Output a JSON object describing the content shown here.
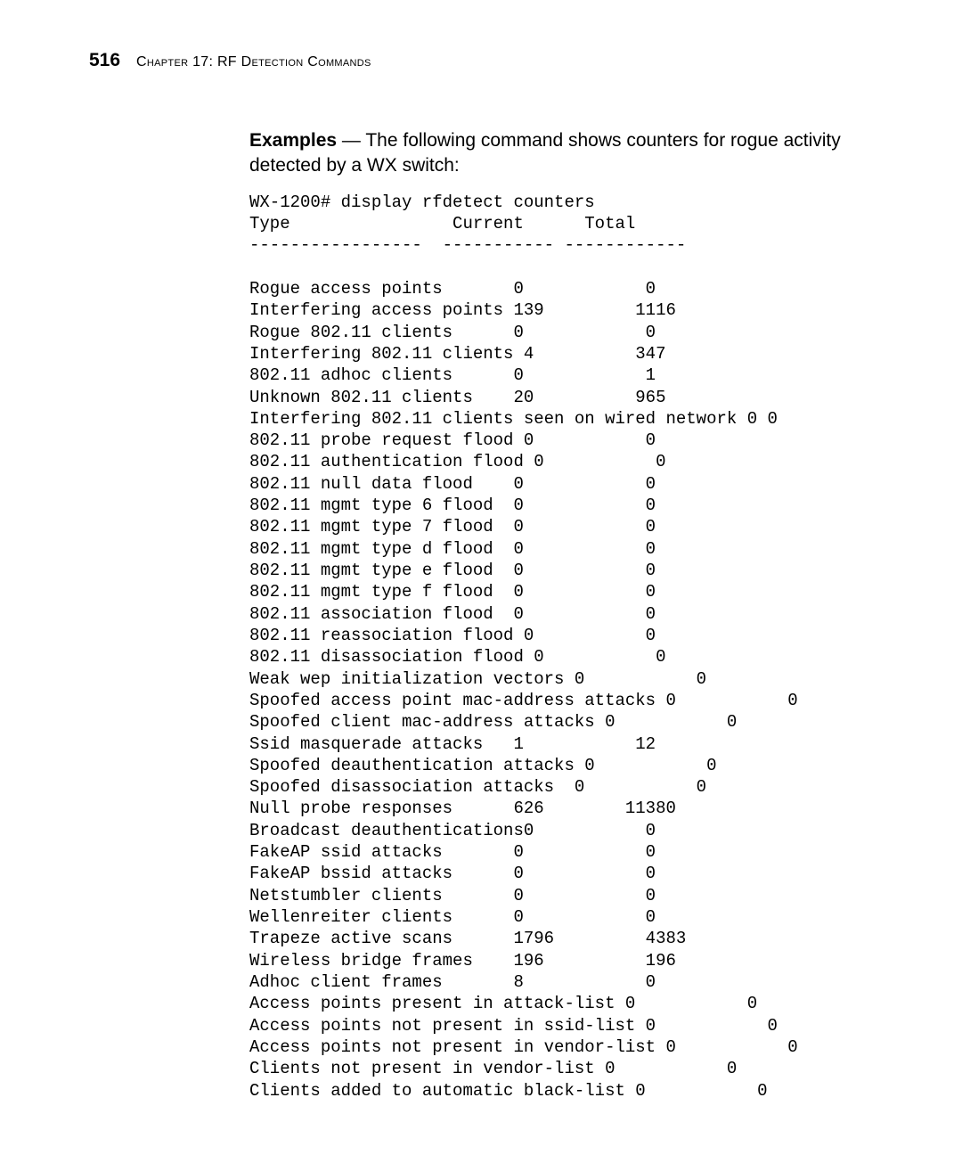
{
  "pageNumber": "516",
  "chapterLabel": "Chapter 17: RF Detection Commands",
  "introHtmlParts": {
    "bold": "Examples",
    "rest": " — The following command shows counters for rogue activity detected by a WX switch:"
  },
  "listing": "WX-1200# display rfdetect counters\nType                Current      Total\n-----------------  ----------- ------------\n\nRogue access points       0            0\nInterfering access points 139         1116\nRogue 802.11 clients      0            0\nInterfering 802.11 clients 4          347\n802.11 adhoc clients      0            1\nUnknown 802.11 clients    20          965\nInterfering 802.11 clients seen on wired network 0 0\n802.11 probe request flood 0           0\n802.11 authentication flood 0           0\n802.11 null data flood    0            0\n802.11 mgmt type 6 flood  0            0\n802.11 mgmt type 7 flood  0            0\n802.11 mgmt type d flood  0            0\n802.11 mgmt type e flood  0            0\n802.11 mgmt type f flood  0            0\n802.11 association flood  0            0\n802.11 reassociation flood 0           0\n802.11 disassociation flood 0           0\nWeak wep initialization vectors 0           0\nSpoofed access point mac-address attacks 0           0\nSpoofed client mac-address attacks 0           0\nSsid masquerade attacks   1           12\nSpoofed deauthentication attacks 0           0\nSpoofed disassociation attacks  0           0\nNull probe responses      626        11380\nBroadcast deauthentications0           0\nFakeAP ssid attacks       0            0\nFakeAP bssid attacks      0            0\nNetstumbler clients       0            0\nWellenreiter clients      0            0\nTrapeze active scans      1796         4383\nWireless bridge frames    196          196\nAdhoc client frames       8            0\nAccess points present in attack-list 0           0\nAccess points not present in ssid-list 0           0\nAccess points not present in vendor-list 0           0\nClients not present in vendor-list 0           0\nClients added to automatic black-list 0           0"
}
